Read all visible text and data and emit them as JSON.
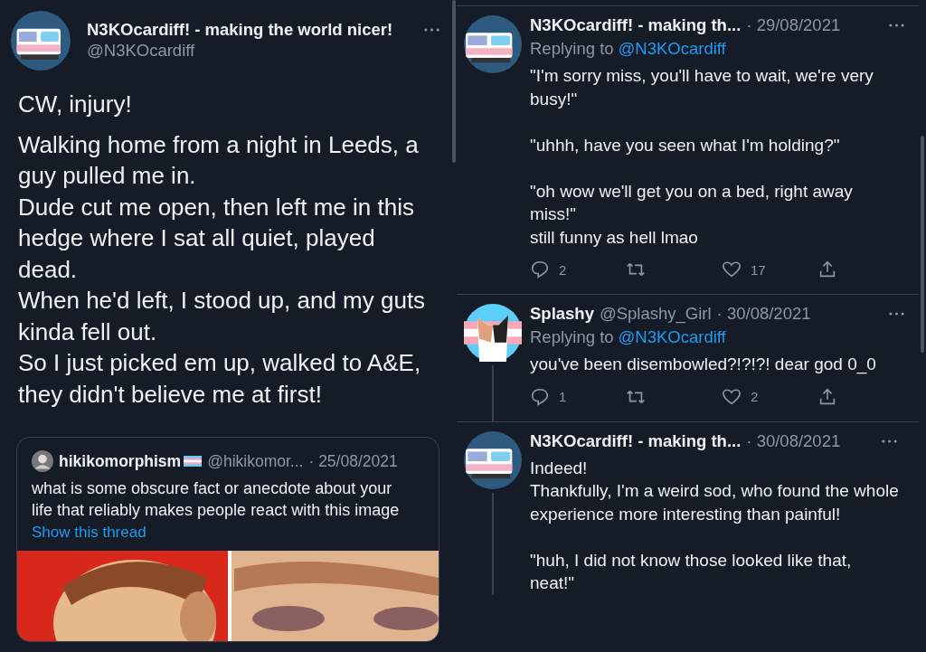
{
  "main_tweet": {
    "author": {
      "name": "N3KOcardiff! - making the world nicer!",
      "handle": "@N3KOcardiff",
      "avatar": {
        "kind": "tram"
      }
    },
    "paragraphs": [
      "CW, injury!",
      "Walking home from a night in Leeds, a guy pulled me in.\nDude cut me open, then left me in this hedge where I sat all quiet, played dead.\nWhen he'd left, I stood up, and my guts kinda fell out.\nSo I just picked em up, walked to A&E, they didn't believe me at first!"
    ],
    "quoted": {
      "name": "hikikomorphism",
      "handle": "@hikikomor...",
      "date": "· 25/08/2021",
      "text": "what is some obscure fact or anecdote about your life that reliably makes people react with this image",
      "link": "Show this thread"
    }
  },
  "replies": [
    {
      "name": "N3KOcardiff! - making th...",
      "date": "· 29/08/2021",
      "avatar": {
        "kind": "tram"
      },
      "replying_to": {
        "label": "Replying to",
        "handle": "@N3KOcardiff"
      },
      "text": "\"I'm sorry miss, you'll have to wait, we're very busy!\"\n\n\"uhhh, have you seen what I'm holding?\"\n\n\"oh wow we'll get you on a bed, right away miss!\"\nstill funny as hell lmao",
      "stats": {
        "replies": "2",
        "likes": "17"
      },
      "thread_line_below": false
    },
    {
      "name": "Splashy",
      "handle": "@Splashy_Girl",
      "date": "· 30/08/2021",
      "avatar": {
        "kind": "cat"
      },
      "replying_to": {
        "label": "Replying to",
        "handle": "@N3KOcardiff"
      },
      "text": "you've been disembowled?!?!?! dear god 0_0",
      "stats": {
        "replies": "1",
        "likes": "2"
      },
      "thread_line_below": true
    },
    {
      "name": "N3KOcardiff! - making th...",
      "date": "· 30/08/2021",
      "avatar": {
        "kind": "tram"
      },
      "text": "Indeed!\nThankfully, I'm a weird sod, who found the whole experience more interesting than painful!\n\n\"huh, I did not know those looked like that, neat!\"",
      "thread_line_below": true
    }
  ]
}
